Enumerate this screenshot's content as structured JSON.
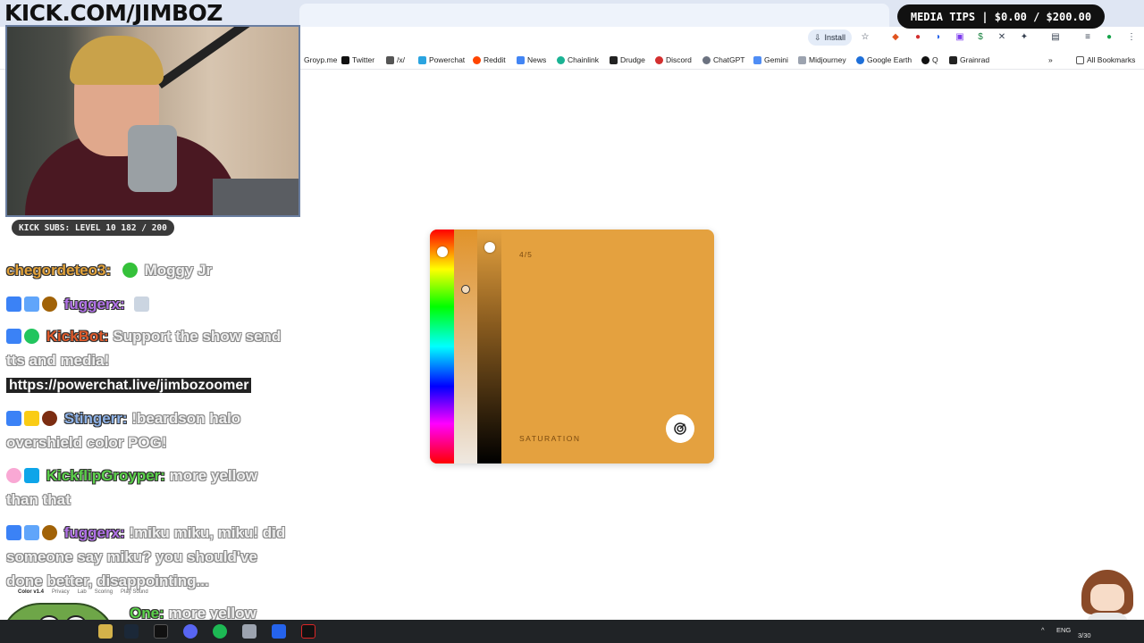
{
  "stream": {
    "logo": "KICK.COM/JIMBOZ",
    "media_tips": "MEDIA TIPS | $0.00 / $200.00",
    "subs": "KICK SUBS: LEVEL 10 182 / 200"
  },
  "browser": {
    "install_label": "Install",
    "all_bookmarks": "All Bookmarks",
    "bookmarks": [
      "Groyp.me",
      "Twitter",
      "/x/",
      "Powerchat",
      "Reddit",
      "News",
      "Chainlink",
      "Drudge",
      "Discord",
      "ChatGPT",
      "Gemini",
      "Midjourney",
      "Google Earth",
      "Q",
      "Grainrad"
    ]
  },
  "chat": [
    {
      "user": "chegordeteo3:",
      "color": "#e2a23a",
      "text": "Moggy Jr"
    },
    {
      "user": "fuggerx:",
      "color": "#b071e6",
      "text": ""
    },
    {
      "user": "KickBot:",
      "color": "#e05a2b",
      "text": "Support the show send",
      "text2": "tts and media!",
      "link": "https://powerchat.live/jimbozoomer"
    },
    {
      "user": "Stingerr:",
      "color": "#8fb3e8",
      "text": "!beardson halo",
      "text2": "overshield color POG!"
    },
    {
      "user": "KickflipGroyper:",
      "color": "#5bd14a",
      "text": "more yellow",
      "text2": "than that"
    },
    {
      "user": "fuggerx:",
      "color": "#b071e6",
      "text": "!miku miku, miku! did",
      "text2": "someone say miku? you should've",
      "text3": "done better, disappointing..."
    },
    {
      "user": "One:",
      "color": "#5bd14a",
      "text": "more yellow"
    }
  ],
  "game": {
    "step": "4/5",
    "mode_label": "SATURATION",
    "current_color": "#e4a13f",
    "footer": [
      "Color v1.4",
      "Privacy",
      "Lab",
      "Scoring",
      "Play Sound"
    ]
  },
  "taskbar": {
    "lang": "ENG",
    "date": "3/30"
  }
}
